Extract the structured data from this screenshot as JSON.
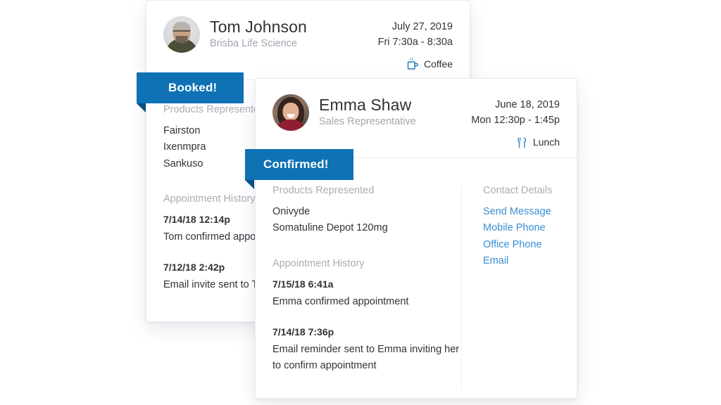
{
  "cards": [
    {
      "id": "tom-johnson-appointment",
      "status_label": "Booked!",
      "person": {
        "name": "Tom Johnson",
        "role": "Brisba Life Science",
        "avatar": "avatar-photo-tom-johnson"
      },
      "schedule": {
        "date": "July 27, 2019",
        "time": "Fri 7:30a - 8:30a",
        "meeting_type": "Coffee",
        "meeting_type_icon": "coffee-cup-icon"
      },
      "products": {
        "label": "Products Represented",
        "items": [
          "Fairston",
          "Ixenmpra",
          "Sankuso"
        ]
      },
      "history": {
        "label": "Appointment History",
        "entries": [
          {
            "date": "7/14/18 12:14p",
            "text": "Tom confirmed appointment"
          },
          {
            "date": "7/12/18 2:42p",
            "text": "Email invite sent to Tom"
          }
        ]
      }
    },
    {
      "id": "emma-shaw-appointment",
      "status_label": "Confirmed!",
      "person": {
        "name": "Emma Shaw",
        "role": "Sales Representative",
        "avatar": "avatar-photo-emma-shaw"
      },
      "schedule": {
        "date": "June 18, 2019",
        "time": "Mon 12:30p - 1:45p",
        "meeting_type": "Lunch",
        "meeting_type_icon": "fork-knife-icon"
      },
      "products": {
        "label": "Products Represented",
        "items": [
          "Onivyde",
          "Somatuline Depot 120mg"
        ]
      },
      "history": {
        "label": "Appointment History",
        "entries": [
          {
            "date": "7/15/18 6:41a",
            "text": "Emma confirmed appointment"
          },
          {
            "date": "7/14/18 7:36p",
            "text": "Email reminder sent to Emma inviting her to confirm appointment"
          }
        ]
      },
      "contact": {
        "label": "Contact Details",
        "links": [
          "Send Message",
          "Mobile Phone",
          "Office Phone",
          "Email"
        ]
      }
    }
  ],
  "colors": {
    "ribbon": "#0f72b5",
    "ribbon_fold": "#0a4f80",
    "link": "#3b8fd4",
    "text": "#2f3337",
    "muted": "#a8aeb5",
    "icon_blue": "#4a9ad4"
  }
}
